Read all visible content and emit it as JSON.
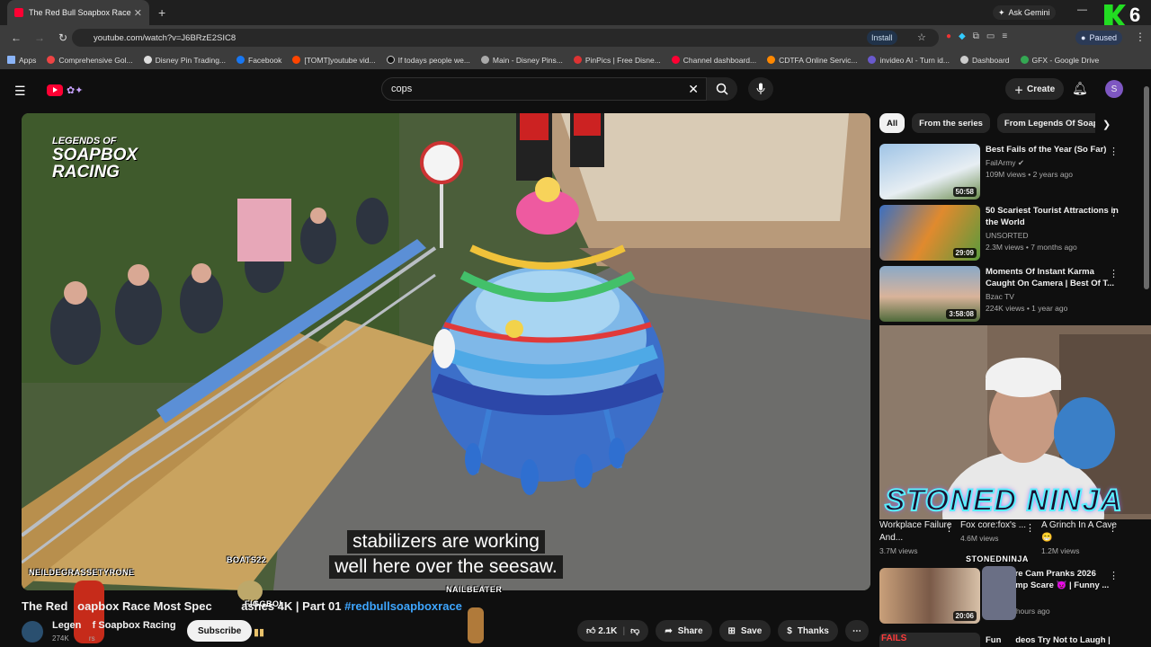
{
  "browser": {
    "tab_title": "The Red Bull Soapbox Race",
    "tab_close": "✕",
    "new_tab": "+",
    "ask_gemini": "Ask Gemini",
    "url": "youtube.com/watch?v=J6BRzE2SIC8",
    "install": "Install",
    "profile_status": "Paused",
    "overlay_number": "6",
    "bookmarks": [
      "Apps",
      "Comprehensive Gol...",
      "Disney Pin Trading...",
      "Facebook",
      "[TOMT]youtube vid...",
      "If todays people we...",
      "Main - Disney Pins...",
      "PinPics | Free Disne...",
      "Channel dashboard...",
      "CDTFA Online Servic...",
      "invideo AI - Turn id...",
      "Dashboard",
      "GFX - Google Drive"
    ]
  },
  "youtube": {
    "search_query": "cops",
    "create_label": "Create",
    "avatar_letter": "S"
  },
  "video": {
    "watermark_line1": "LEGENDS OF",
    "watermark_line2": "SOAPBOX",
    "watermark_line3": "RACING",
    "captions": [
      "stabilizers are working",
      "well here over the seesaw."
    ],
    "overlay_tags": [
      "NEILDEGRASSETYRONE",
      "BOATS22",
      "FIGGBOI",
      "NAILBEATER",
      "STONEDNINJA"
    ],
    "title_part1": "The Red ",
    "title_part2": "oapbox Race Most Spec",
    "title_part3": "ashes 4K | Part 01 ",
    "hashtag": "#redbullsoapboxrace",
    "channel_name": "Legen",
    "channel_name_end": "f Soapbox Racing",
    "subscribers": "274K",
    "subscribers_end": "rs",
    "subscribe_label": "Subscribe",
    "likes": "2.1K",
    "share_label": "Share",
    "save_label": "Save",
    "thanks_label": "Thanks"
  },
  "sidebar": {
    "chips": [
      "All",
      "From the series",
      "From Legends Of Soapbo"
    ],
    "recommendations": [
      {
        "title": "Best Fails of the Year (So Far)",
        "channel": "FailArmy",
        "meta": "109M views • 2 years ago",
        "duration": "50:58"
      },
      {
        "title": "50 Scariest Tourist Attractions in the World",
        "channel": "UNSORTED",
        "meta": "2.3M views • 7 months ago",
        "duration": "29:09"
      },
      {
        "title": "Moments Of Instant Karma Caught On Camera | Best Of T...",
        "channel": "Bzac TV",
        "meta": "224K views • 1 year ago",
        "duration": "3:58:08"
      }
    ],
    "webcam_overlay": "STONED NINJA",
    "shorts": [
      {
        "title": "Workplace Failure And...",
        "views": "3.7M views"
      },
      {
        "title": "Fox core:fox's ...",
        "views": "4.6M views"
      },
      {
        "title": "A Grinch In A Cave 😁",
        "views": "1.2M views"
      }
    ],
    "more": [
      {
        "title": "care Cam Pranks 2026 Jump Scare 😈 | Funny ...",
        "meta": "15 hours ago",
        "duration": "20:06"
      },
      {
        "title": "Fun      deos Try Not to Laugh |",
        "thumb_text": "FAILS"
      }
    ]
  }
}
